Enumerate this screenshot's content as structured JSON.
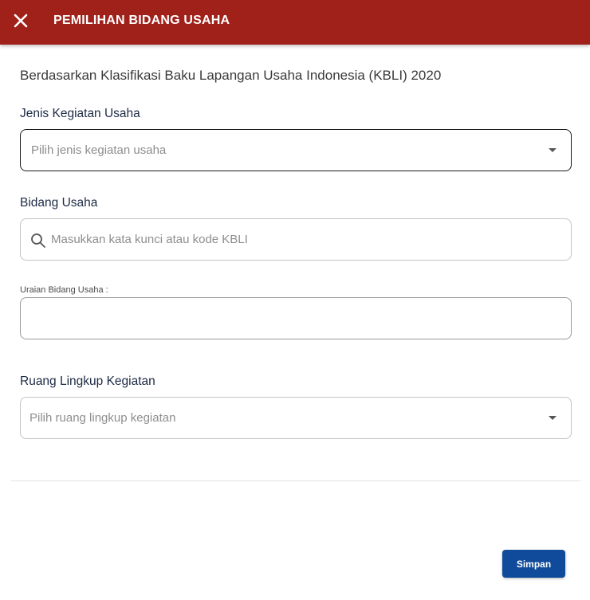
{
  "header": {
    "title": "PEMILIHAN BIDANG USAHA",
    "close_icon": "close-icon",
    "background_color": "#a0211a"
  },
  "form": {
    "subtitle": "Berdasarkan Klasifikasi Baku Lapangan Usaha Indonesia (KBLI) 2020",
    "jenis_kegiatan": {
      "label": "Jenis Kegiatan Usaha",
      "placeholder": "Pilih jenis kegiatan usaha"
    },
    "bidang_usaha": {
      "label": "Bidang Usaha",
      "placeholder": "Masukkan kata kunci atau kode KBLI",
      "icon": "search-icon"
    },
    "uraian": {
      "label": "Uraian Bidang Usaha :",
      "value": ""
    },
    "ruang_lingkup": {
      "label": "Ruang Lingkup Kegiatan",
      "placeholder": "Pilih ruang lingkup kegiatan"
    }
  },
  "footer": {
    "save_label": "Simpan",
    "save_color": "#0f4b9a"
  }
}
